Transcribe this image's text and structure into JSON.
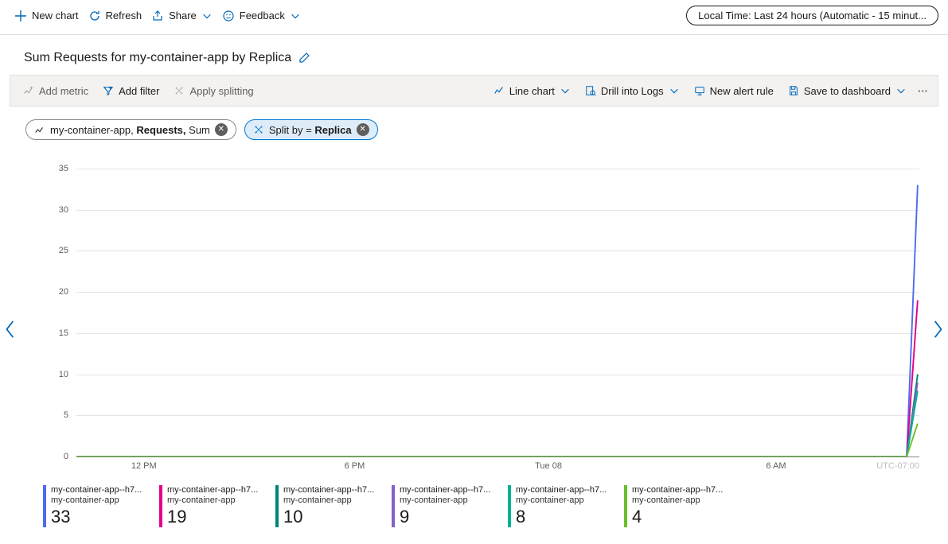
{
  "toolbar": {
    "new_chart": "New chart",
    "refresh": "Refresh",
    "share": "Share",
    "feedback": "Feedback",
    "time_range": "Local Time: Last 24 hours (Automatic - 15 minut..."
  },
  "title": "Sum Requests for my-container-app by Replica",
  "greybar": {
    "add_metric": "Add metric",
    "add_filter": "Add filter",
    "apply_splitting": "Apply splitting",
    "chart_type": "Line chart",
    "drill_logs": "Drill into Logs",
    "new_alert": "New alert rule",
    "save_dash": "Save to dashboard"
  },
  "pills": {
    "metric_prefix": "my-container-app, ",
    "metric_bold": "Requests,",
    "metric_suffix": " Sum",
    "split_prefix": "Split by = ",
    "split_bold": "Replica"
  },
  "chart_data": {
    "type": "line",
    "title": "Sum Requests for my-container-app by Replica",
    "xlabel": "",
    "ylabel": "",
    "ylim": [
      0,
      35
    ],
    "y_ticks": [
      0,
      5,
      10,
      15,
      20,
      25,
      30,
      35
    ],
    "x_ticks": [
      "12 PM",
      "6 PM",
      "Tue 08",
      "6 AM"
    ],
    "timezone": "UTC-07:00",
    "categories_note": "96 15-minute buckets over 24h; all series flat at 0 until final bucket",
    "series": [
      {
        "name": "my-container-app--h7... (replica 1)",
        "color": "#4f6bed",
        "final_value": 33
      },
      {
        "name": "my-container-app--h7... (replica 2)",
        "color": "#e3008c",
        "final_value": 19
      },
      {
        "name": "my-container-app--h7... (replica 3)",
        "color": "#008575",
        "final_value": 10
      },
      {
        "name": "my-container-app--h7... (replica 4)",
        "color": "#8661c5",
        "final_value": 9
      },
      {
        "name": "my-container-app--h7... (replica 5)",
        "color": "#00b294",
        "final_value": 8
      },
      {
        "name": "my-container-app--h7... (replica 6)",
        "color": "#69bf29",
        "final_value": 4
      }
    ]
  },
  "legend": {
    "sub": "my-container-app",
    "items": [
      {
        "name": "my-container-app--h7...",
        "value": "33",
        "color": "#4f6bed"
      },
      {
        "name": "my-container-app--h7...",
        "value": "19",
        "color": "#e3008c"
      },
      {
        "name": "my-container-app--h7...",
        "value": "10",
        "color": "#008575"
      },
      {
        "name": "my-container-app--h7...",
        "value": "9",
        "color": "#8661c5"
      },
      {
        "name": "my-container-app--h7...",
        "value": "8",
        "color": "#00b294"
      },
      {
        "name": "my-container-app--h7...",
        "value": "4",
        "color": "#69bf29"
      }
    ]
  }
}
